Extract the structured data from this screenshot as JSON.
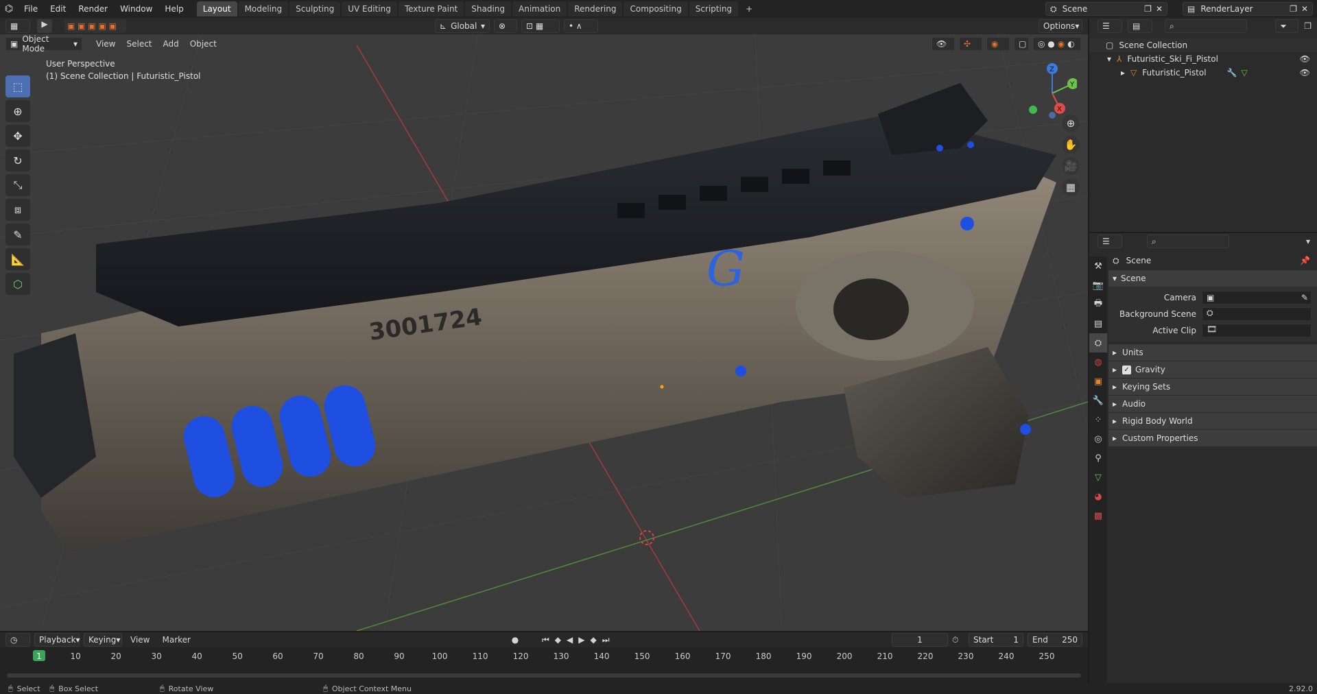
{
  "topbar": {
    "menus": [
      "File",
      "Edit",
      "Render",
      "Window",
      "Help"
    ],
    "tabs": [
      "Layout",
      "Modeling",
      "Sculpting",
      "UV Editing",
      "Texture Paint",
      "Shading",
      "Animation",
      "Rendering",
      "Compositing",
      "Scripting"
    ],
    "active_tab": "Layout",
    "add_tab": "+",
    "scene_name": "Scene",
    "render_layer": "RenderLayer"
  },
  "viewport_header": {
    "transform_orientation": "Global",
    "options_label": "Options",
    "mode": "Object Mode",
    "menus": [
      "View",
      "Select",
      "Add",
      "Object"
    ]
  },
  "viewport": {
    "perspective_label": "User Perspective",
    "collection_label": "(1) Scene Collection | Futuristic_Pistol",
    "serial_number": "3001724",
    "gizmo_axes": [
      "Z",
      "Y",
      "X"
    ]
  },
  "outliner": {
    "root": "Scene Collection",
    "items": [
      {
        "label": "Futuristic_Ski_Fi_Pistol",
        "level": 1
      },
      {
        "label": "Futuristic_Pistol",
        "level": 2
      }
    ]
  },
  "properties": {
    "context": "Scene",
    "panel_title": "Scene",
    "fields": [
      {
        "label": "Camera"
      },
      {
        "label": "Background Scene"
      },
      {
        "label": "Active Clip"
      }
    ],
    "subpanels": [
      "Units",
      "Gravity",
      "Keying Sets",
      "Audio",
      "Rigid Body World",
      "Custom Properties"
    ],
    "gravity_checked": true
  },
  "timeline": {
    "menus": [
      "Playback",
      "Keying",
      "View",
      "Marker"
    ],
    "current_frame": "1",
    "start_label": "Start",
    "start_value": "1",
    "end_label": "End",
    "end_value": "250",
    "ruler": [
      "1",
      "10",
      "20",
      "30",
      "40",
      "50",
      "60",
      "70",
      "80",
      "90",
      "100",
      "110",
      "120",
      "130",
      "140",
      "150",
      "160",
      "170",
      "180",
      "190",
      "200",
      "210",
      "220",
      "230",
      "240",
      "250"
    ]
  },
  "statusbar": {
    "items": [
      "Select",
      "Box Select",
      "Rotate View",
      "Object Context Menu"
    ],
    "version": "2.92.0"
  },
  "colors": {
    "accent": "#4b6fb0",
    "active_tab": "#474747",
    "viewport_bg": "#3c3c3c",
    "glow_blue": "#1f4fe0"
  }
}
